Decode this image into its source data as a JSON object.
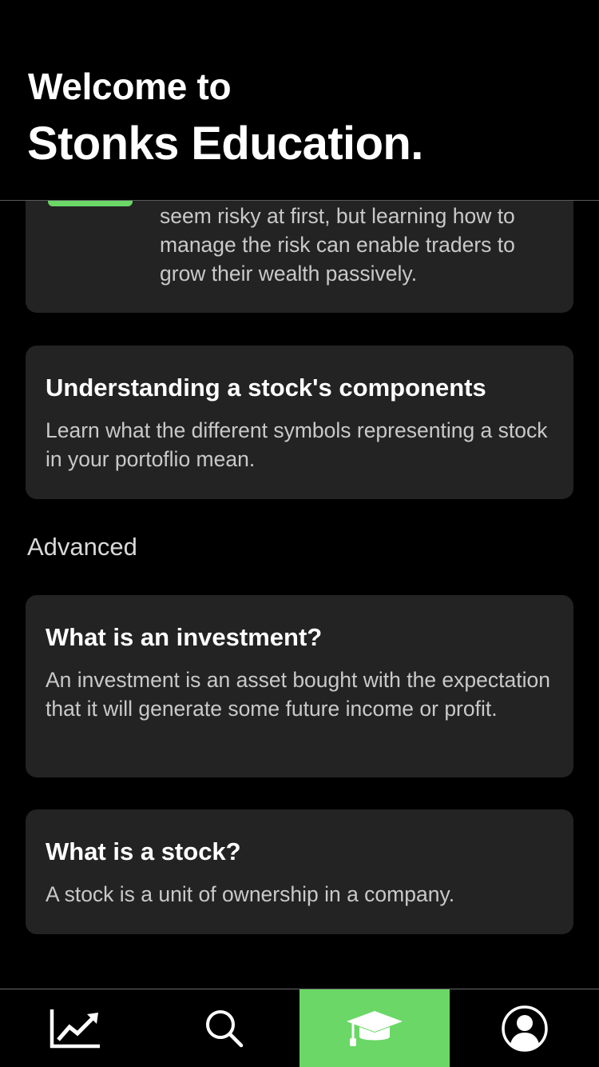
{
  "header": {
    "line1": "Welcome to",
    "line2": "Stonks Education."
  },
  "cards": {
    "risk": {
      "desc": "seem risky at first, but learning how to manage the risk can enable traders to grow their wealth passively."
    },
    "components": {
      "title": "Understanding a stock's components",
      "desc": "Learn what the different symbols representing a stock in your portoflio mean."
    },
    "investment": {
      "title": "What is an investment?",
      "desc": "An investment is an asset bought with the expectation that it will generate some future income or profit."
    },
    "stock": {
      "title": "What is a stock?",
      "desc": "A stock is a unit of ownership in a company."
    }
  },
  "sections": {
    "advanced": "Advanced"
  },
  "tabbar": {
    "items": [
      {
        "icon": "chart-line-icon",
        "active": false
      },
      {
        "icon": "search-icon",
        "active": false
      },
      {
        "icon": "graduation-cap-icon",
        "active": true
      },
      {
        "icon": "user-circle-icon",
        "active": false
      }
    ]
  },
  "colors": {
    "background": "#000000",
    "card": "#232323",
    "accent": "#6ad766",
    "text_primary": "#ffffff",
    "text_secondary": "#c9c9c9"
  }
}
